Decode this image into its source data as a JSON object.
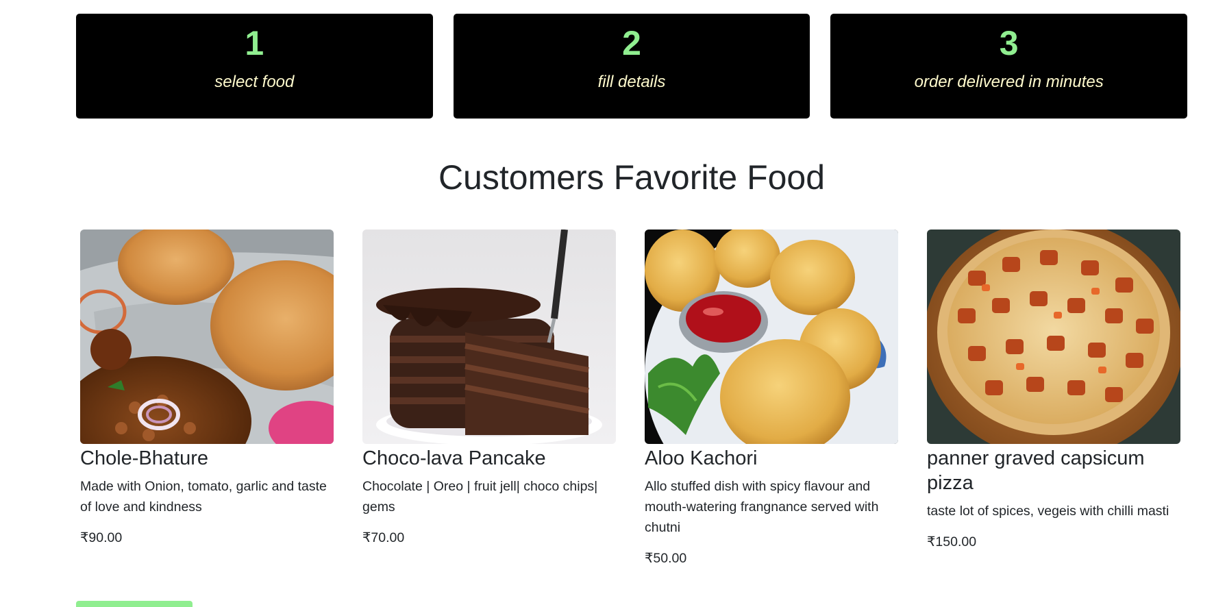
{
  "steps": [
    {
      "number": "1",
      "text": "select food"
    },
    {
      "number": "2",
      "text": "fill details"
    },
    {
      "number": "3",
      "text": "order delivered in minutes"
    }
  ],
  "colors": {
    "step_number": "#90ee90",
    "step_text": "#fffacd",
    "step_bg": "#000000",
    "button_bg": "#90ee90"
  },
  "section": {
    "title": "Customers Favorite Food"
  },
  "foods": [
    {
      "name": "Chole-Bhature",
      "description": "Made with Onion, tomato, garlic and taste of love and kindness",
      "price": "₹90.00",
      "image_icon": "chole-bhature-photo"
    },
    {
      "name": "Choco-lava Pancake",
      "description": "Chocolate | Oreo | fruit jell| choco chips| gems",
      "price": "₹70.00",
      "image_icon": "choco-lava-pancake-photo"
    },
    {
      "name": "Aloo Kachori",
      "description": "Allo stuffed dish with spicy flavour and mouth-watering frangnance served with chutni",
      "price": "₹50.00",
      "image_icon": "aloo-kachori-photo"
    },
    {
      "name": "panner graved capsicum pizza",
      "description": "taste lot of spices, vegeis with chilli masti",
      "price": "₹150.00",
      "image_icon": "paneer-pizza-photo"
    }
  ]
}
